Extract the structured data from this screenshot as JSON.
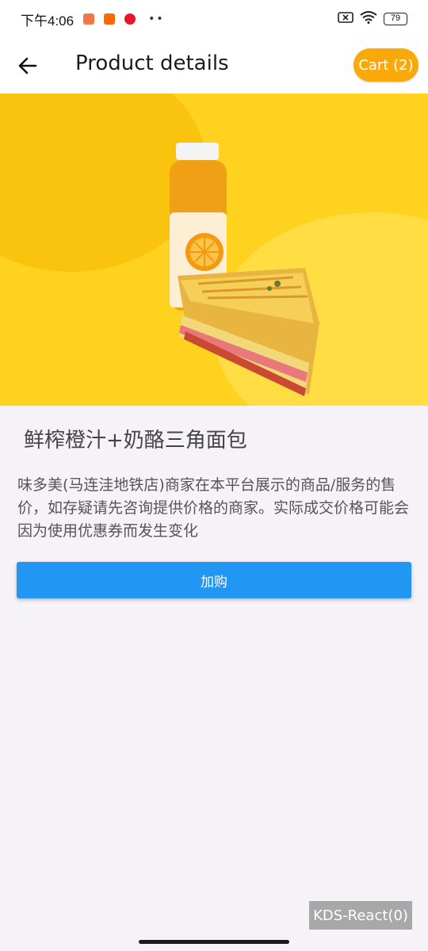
{
  "status_bar": {
    "time": "下午4:06",
    "dots": "••",
    "battery": "79",
    "icons": [
      "app-notification-icon",
      "mi-icon",
      "weibo-icon",
      "sim-off-icon",
      "wifi-icon",
      "battery-icon"
    ]
  },
  "app_bar": {
    "title": "Product details",
    "cart_label": "Cart (2)",
    "back_icon": "back-arrow-icon"
  },
  "product": {
    "name": "鲜榨橙汁+奶酪三角面包",
    "description": "味多美(马连洼地铁店)商家在本平台展示的商品/服务的售价，如存疑请先咨询提供价格的商家。实际成交价格可能会因为使用优惠券而发生变化",
    "add_button_label": "加购"
  },
  "debug_badge": "KDS-React(0)",
  "colors": {
    "accent_orange": "#f9a90a",
    "primary_blue": "#2196f3",
    "hero_yellow": "#ffd21f"
  }
}
